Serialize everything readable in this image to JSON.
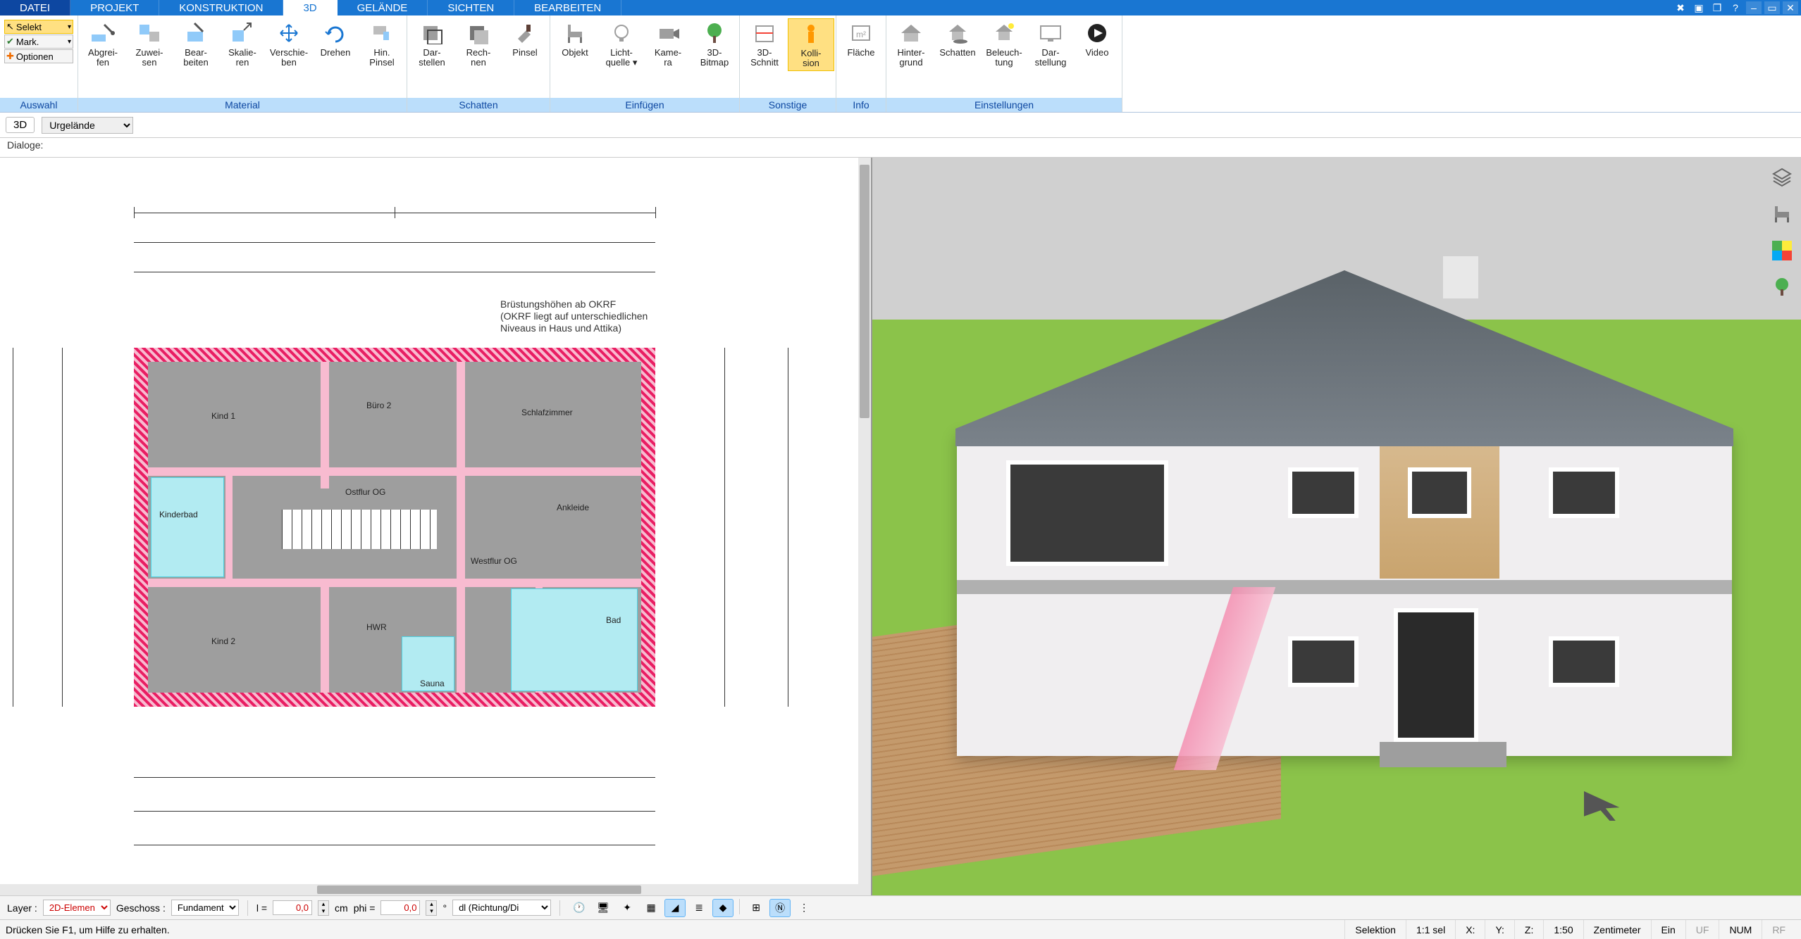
{
  "tabs": {
    "file": "DATEI",
    "items": [
      "PROJEKT",
      "KONSTRUKTION",
      "3D",
      "GELÄNDE",
      "SICHTEN",
      "BEARBEITEN"
    ],
    "active_index": 2
  },
  "ribbon": {
    "auswahl": {
      "title": "Auswahl",
      "selekt": "Selekt",
      "mark": "Mark.",
      "optionen": "Optionen"
    },
    "material": {
      "title": "Material",
      "buttons": [
        {
          "id": "abgreifen",
          "l1": "Abgrei-",
          "l2": "fen"
        },
        {
          "id": "zuweisen",
          "l1": "Zuwei-",
          "l2": "sen"
        },
        {
          "id": "bearbeiten",
          "l1": "Bear-",
          "l2": "beiten"
        },
        {
          "id": "skalieren",
          "l1": "Skalie-",
          "l2": "ren"
        },
        {
          "id": "verschieben",
          "l1": "Verschie-",
          "l2": "ben"
        },
        {
          "id": "drehen",
          "l1": "Drehen",
          "l2": ""
        },
        {
          "id": "hinpinsel",
          "l1": "Hin.",
          "l2": "Pinsel"
        }
      ]
    },
    "schatten": {
      "title": "Schatten",
      "buttons": [
        {
          "id": "darstellen",
          "l1": "Dar-",
          "l2": "stellen"
        },
        {
          "id": "rechnen",
          "l1": "Rech-",
          "l2": "nen"
        },
        {
          "id": "pinsel",
          "l1": "Pinsel",
          "l2": ""
        }
      ]
    },
    "einfuegen": {
      "title": "Einfügen",
      "buttons": [
        {
          "id": "objekt",
          "l1": "Objekt",
          "l2": ""
        },
        {
          "id": "lichtquelle",
          "l1": "Licht-",
          "l2": "quelle ▾"
        },
        {
          "id": "kamera",
          "l1": "Kame-",
          "l2": "ra"
        },
        {
          "id": "3dbitmap",
          "l1": "3D-",
          "l2": "Bitmap"
        }
      ]
    },
    "sonstige": {
      "title": "Sonstige",
      "buttons": [
        {
          "id": "3dschnitt",
          "l1": "3D-",
          "l2": "Schnitt"
        },
        {
          "id": "kollision",
          "l1": "Kolli-",
          "l2": "sion",
          "active": true
        }
      ]
    },
    "info": {
      "title": "Info",
      "buttons": [
        {
          "id": "flaeche",
          "l1": "Fläche",
          "l2": ""
        }
      ]
    },
    "einstellungen": {
      "title": "Einstellungen",
      "buttons": [
        {
          "id": "hintergrund",
          "l1": "Hinter-",
          "l2": "grund"
        },
        {
          "id": "schatten",
          "l1": "Schatten",
          "l2": ""
        },
        {
          "id": "beleuchtung",
          "l1": "Beleuch-",
          "l2": "tung"
        },
        {
          "id": "darstellung",
          "l1": "Dar-",
          "l2": "stellung"
        },
        {
          "id": "video",
          "l1": "Video",
          "l2": ""
        }
      ]
    }
  },
  "subbar": {
    "mode": "3D",
    "terrain_label": "Urgelände"
  },
  "dialoge": {
    "label": "Dialoge:"
  },
  "plan": {
    "note_l1": "Brüstungshöhen ab OKRF",
    "note_l2": "(OKRF liegt auf unterschiedlichen",
    "note_l3": "Niveaus in Haus und Attika)",
    "rooms": {
      "kind1": "Kind 1",
      "kind2": "Kind 2",
      "buero2": "Büro 2",
      "schlafzimmer": "Schlafzimmer",
      "ostflur": "Ostflur OG",
      "westflur": "Westflur OG",
      "ankleide": "Ankleide",
      "kinderbad": "Kinderbad",
      "hwr": "HWR",
      "sauna": "Sauna",
      "bad": "Bad"
    }
  },
  "right_tools": {
    "layers": "layers-icon",
    "furniture": "furniture-icon",
    "colors": "color-palette-icon",
    "tree": "tree-icon"
  },
  "bottombar": {
    "layer_label": "Layer :",
    "layer_value": "2D-Elemen",
    "geschoss_label": "Geschoss :",
    "geschoss_value": "Fundament",
    "l_label": "l =",
    "l_value": "0,0",
    "l_unit": "cm",
    "phi_label": "phi =",
    "phi_value": "0,0",
    "phi_unit": "°",
    "mode": "dl (Richtung/Di"
  },
  "statusbar": {
    "help": "Drücken Sie F1, um Hilfe zu erhalten.",
    "selektion": "Selektion",
    "ratio": "1:1 sel",
    "x": "X:",
    "y": "Y:",
    "z": "Z:",
    "scale": "1:50",
    "unit": "Zentimeter",
    "ein": "Ein",
    "uf": "UF",
    "num": "NUM",
    "rf": "RF"
  },
  "colors": {
    "tab_active_bg": "#ffffff",
    "tab_bg": "#1976d2",
    "ribbon_title_bg": "#bbdefb",
    "accent_yellow": "#ffe082"
  }
}
